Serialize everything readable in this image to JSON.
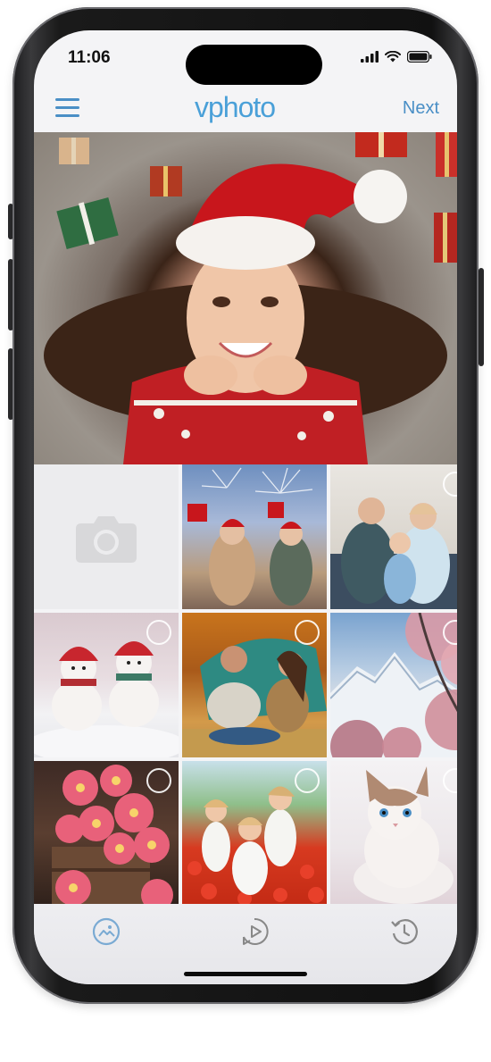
{
  "status_bar": {
    "time": "11:06"
  },
  "header": {
    "logo": "vphoto",
    "next_label": "Next"
  },
  "colors": {
    "accent": "#4a8fc6",
    "logo": "#4aa0d8",
    "tab_icon": "#7aaad3",
    "tab_icon_inactive": "#888888"
  },
  "photos": [
    {
      "name": "woman-in-santa-hat",
      "selected": true
    },
    {
      "name": "camera-placeholder"
    },
    {
      "name": "new-year-fireworks-friends"
    },
    {
      "name": "family-at-home"
    },
    {
      "name": "snowmen"
    },
    {
      "name": "couple-autumn-picnic"
    },
    {
      "name": "mountain-blossom"
    },
    {
      "name": "pink-gerberas-crate"
    },
    {
      "name": "children-poppy-field"
    },
    {
      "name": "white-kitten"
    }
  ],
  "tabs": [
    {
      "name": "gallery-tab",
      "icon": "photo-icon",
      "active": true
    },
    {
      "name": "video-tab",
      "icon": "play-icon",
      "active": false
    },
    {
      "name": "history-tab",
      "icon": "history-icon",
      "active": false
    }
  ]
}
